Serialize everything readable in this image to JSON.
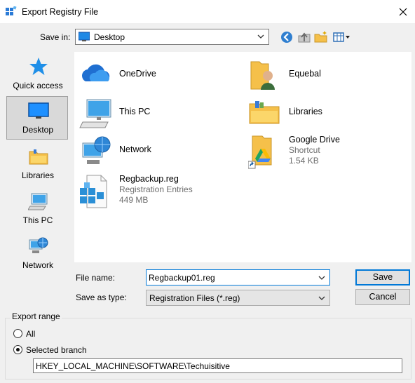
{
  "window": {
    "title": "Export Registry File"
  },
  "toolbar": {
    "save_in_label": "Save in:",
    "save_in_value": "Desktop"
  },
  "places": [
    {
      "label": "Quick access",
      "icon": "star-icon"
    },
    {
      "label": "Desktop",
      "icon": "desktop-icon",
      "selected": true
    },
    {
      "label": "Libraries",
      "icon": "libraries-icon"
    },
    {
      "label": "This PC",
      "icon": "computer-icon"
    },
    {
      "label": "Network",
      "icon": "network-icon"
    }
  ],
  "files": [
    {
      "name": "OneDrive",
      "icon": "onedrive-icon"
    },
    {
      "name": "Equebal",
      "icon": "user-folder-icon"
    },
    {
      "name": "This PC",
      "icon": "computer-icon"
    },
    {
      "name": "Libraries",
      "icon": "libraries-icon"
    },
    {
      "name": "Network",
      "icon": "network-icon"
    },
    {
      "name": "Google Drive",
      "sub1": "Shortcut",
      "sub2": "1.54 KB",
      "icon": "google-drive-shortcut-icon"
    },
    {
      "name": "Regbackup.reg",
      "sub1": "Registration Entries",
      "sub2": "449 MB",
      "icon": "registry-file-icon"
    }
  ],
  "form": {
    "file_name_label": "File name:",
    "file_name_value": "Regbackup01.reg",
    "save_as_type_label": "Save as type:",
    "save_as_type_value": "Registration Files (*.reg)",
    "save_button": "Save",
    "cancel_button": "Cancel"
  },
  "export_range": {
    "legend": "Export range",
    "all_label": "All",
    "selected_label": "Selected branch",
    "selected": "selected_branch",
    "branch_value": "HKEY_LOCAL_MACHINE\\SOFTWARE\\Techuisitive"
  }
}
